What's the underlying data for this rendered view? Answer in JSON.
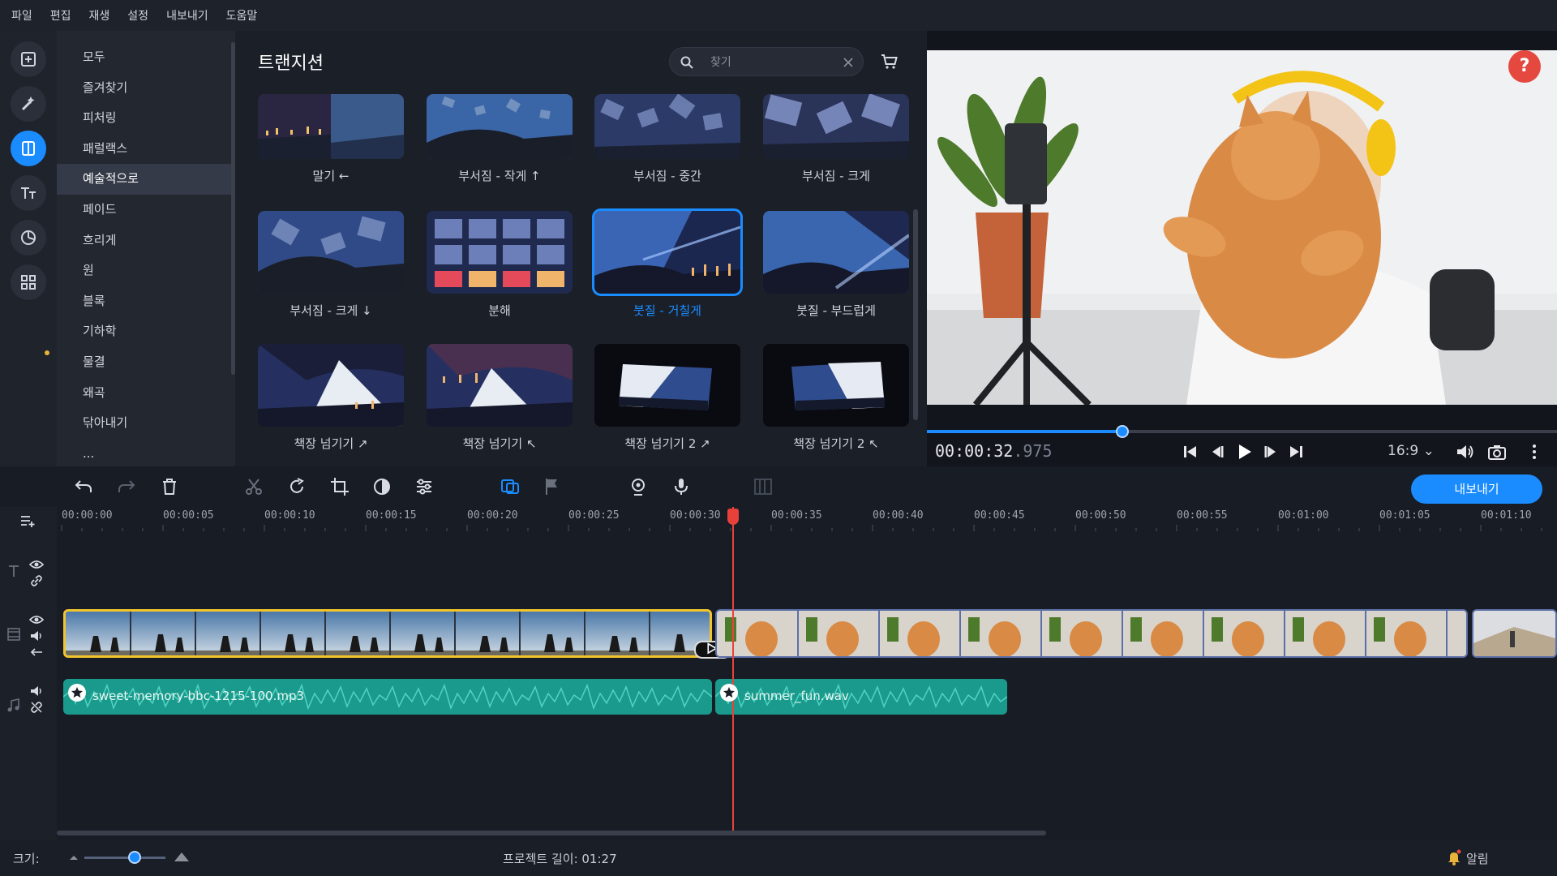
{
  "menu": [
    "파일",
    "편집",
    "재생",
    "설정",
    "내보내기",
    "도움말"
  ],
  "categories": [
    "모두",
    "즐겨찾기",
    "피처링",
    "패럴랙스",
    "예술적으로",
    "페이드",
    "흐리게",
    "원",
    "블록",
    "기하학",
    "물결",
    "왜곡",
    "닦아내기",
    "..."
  ],
  "selected_category": "예술적으로",
  "transitions": {
    "title": "트랜지션",
    "search_placeholder": "찾기",
    "tiles": [
      {
        "label": "말기 ←"
      },
      {
        "label": "부서짐 - 작게 ↑"
      },
      {
        "label": "부서짐 - 중간"
      },
      {
        "label": "부서짐 - 크게"
      },
      {
        "label": "부서짐 - 크게 ↓"
      },
      {
        "label": "분해"
      },
      {
        "label": "붓질 - 거칠게",
        "selected": true
      },
      {
        "label": "붓질 - 부드럽게"
      },
      {
        "label": "책장 넘기기 ↗"
      },
      {
        "label": "책장 넘기기 ↖"
      },
      {
        "label": "책장 넘기기 2 ↗"
      },
      {
        "label": "책장 넘기기 2 ↖"
      }
    ]
  },
  "preview": {
    "help": "?",
    "timecode_main": "00:00:32",
    "timecode_ms": ".975",
    "progress_fraction": 0.31,
    "aspect": "16:9 ⌄"
  },
  "toolbar": {
    "export_label": "내보내기"
  },
  "timeline": {
    "ruler": [
      "00:00:00",
      "00:00:05",
      "00:00:10",
      "00:00:15",
      "00:00:20",
      "00:00:25",
      "00:00:30",
      "00:00:35",
      "00:00:40",
      "00:00:45",
      "00:00:50",
      "00:00:55",
      "00:01:00",
      "00:01:05",
      "00:01:10"
    ],
    "audio_clips": [
      {
        "name": "sweet-memory-bbc-1215-100.mp3"
      },
      {
        "name": "summer_fun.wav"
      }
    ]
  },
  "status": {
    "size_label": "크기:",
    "project_length": "프로젝트 길이:  01:27",
    "notifications": "알림"
  },
  "colors": {
    "accent": "#1a8cff",
    "clip_border": "#f2c42c",
    "audio": "#1a9a8c",
    "playhead": "#e8413a"
  }
}
